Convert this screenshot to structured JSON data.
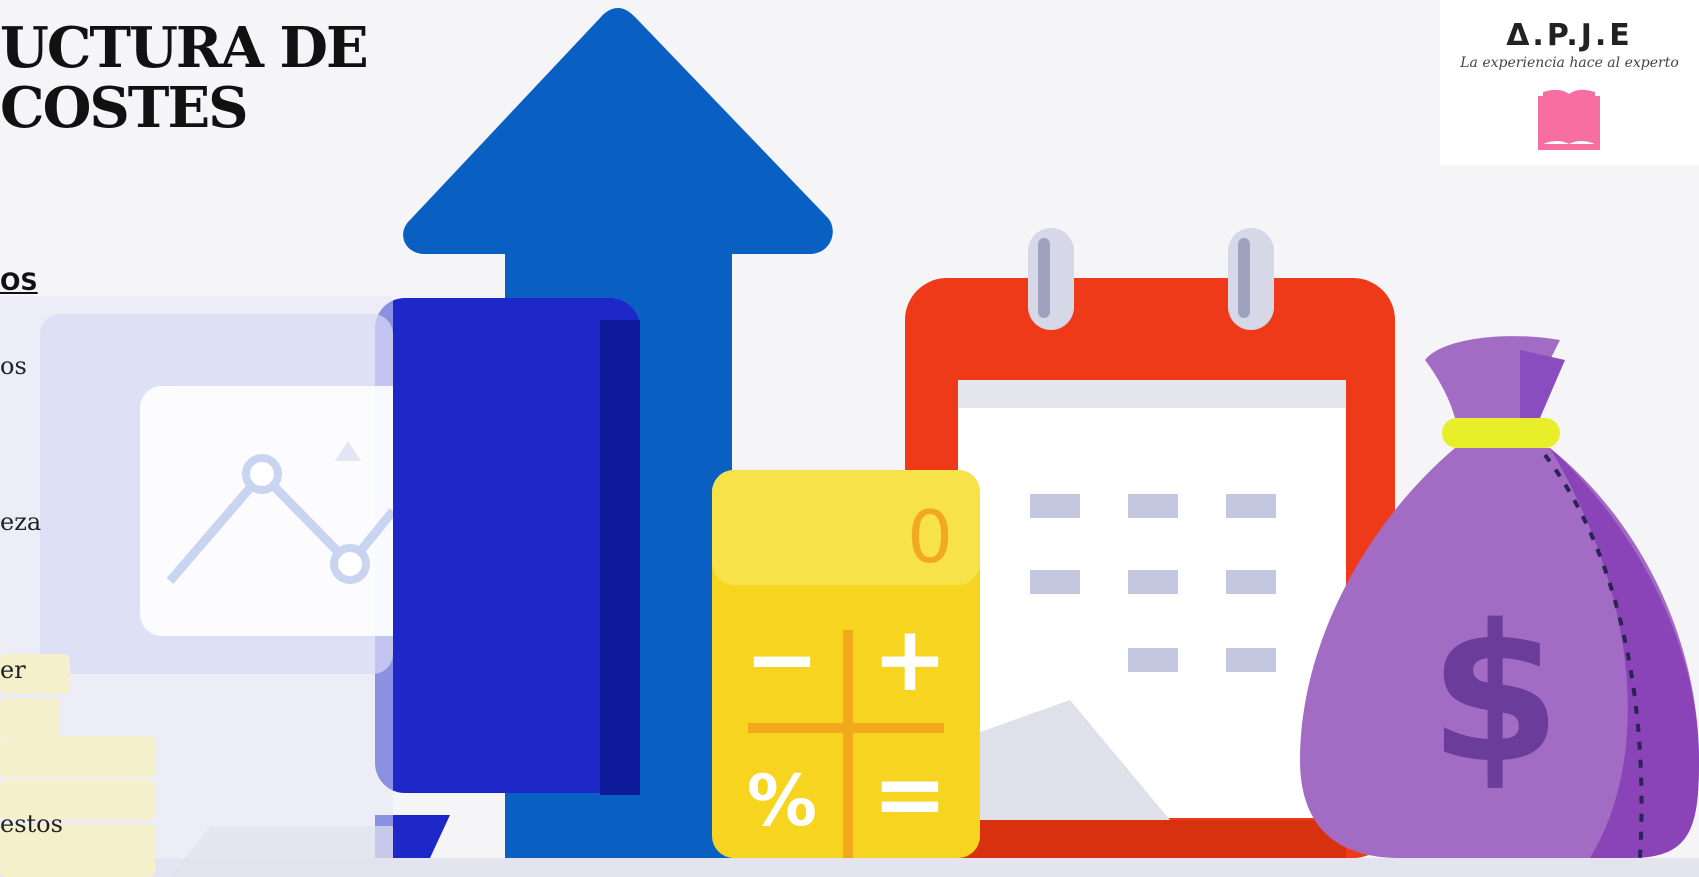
{
  "slide": {
    "title_line1": "UCTURA DE",
    "title_line2": "COSTES",
    "section_heading": "OS",
    "items": [
      {
        "label": "os"
      },
      {
        "label": "eza"
      },
      {
        "label": "er"
      },
      {
        "label": "estos"
      }
    ]
  },
  "logo": {
    "brand": "Δ.P.J.E",
    "tagline": "La experiencia hace al experto"
  },
  "illustration": {
    "calculator_display": "0",
    "calculator_keys": [
      "−",
      "+",
      "%",
      "="
    ],
    "bag_symbol": "$"
  },
  "colors": {
    "arrow_blue": "#0a5fc2",
    "monitor_blue": "#1e28c9",
    "calendar_red": "#ee3a19",
    "calculator_yellow": "#f6d420",
    "bag_purple": "#a26bc4",
    "book_pink": "#f76fa0"
  }
}
